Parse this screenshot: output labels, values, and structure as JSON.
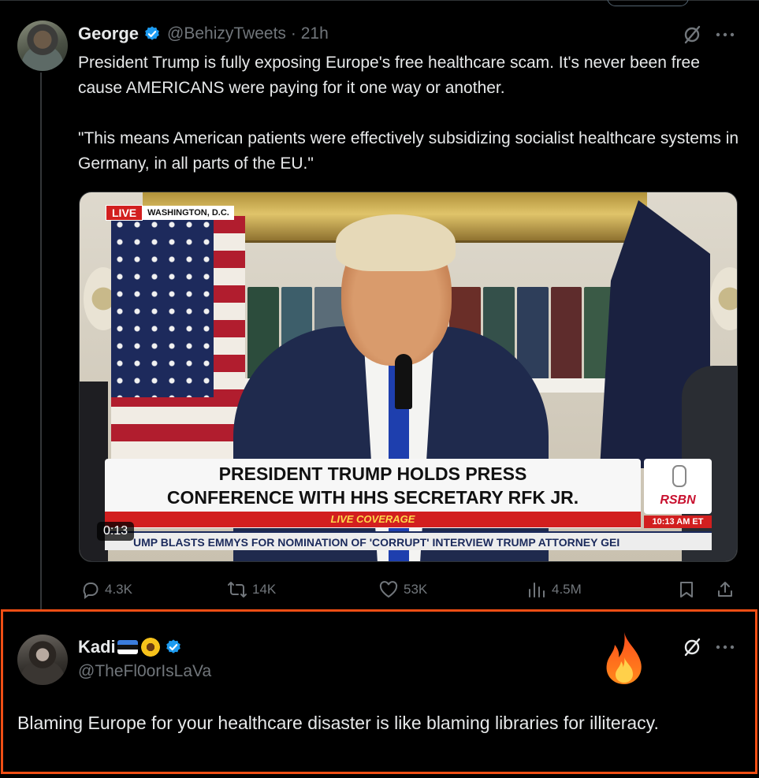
{
  "tweet": {
    "author_name": "George",
    "author_handle": "@BehizyTweets",
    "time": "· 21h",
    "text_p1": "President Trump is fully exposing Europe's free healthcare scam. It's never been free cause AMERICANS were paying for it one way or another.",
    "text_p2": "\"This means American patients were effectively subsidizing socialist healthcare systems in Germany, in all parts of the EU.\"",
    "media": {
      "live_label": "LIVE",
      "location": "WASHINGTON, D.C.",
      "headline": "PRESIDENT TRUMP HOLDS PRESS\nCONFERENCE WITH HHS SECRETARY RFK JR.",
      "live_coverage": "LIVE COVERAGE",
      "network": "RSBN",
      "clock": "10:13 AM ET",
      "ticker": "UMP BLASTS EMMYS FOR NOMINATION OF 'CORRUPT' INTERVIEW     TRUMP ATTORNEY GEI",
      "timestamp": "0:13"
    },
    "stats": {
      "replies": "4.3K",
      "reposts": "14K",
      "likes": "53K",
      "views": "4.5M"
    }
  },
  "reply": {
    "author_name": "Kadi",
    "author_handle": "@TheFl0orIsLaVa",
    "text": "Blaming Europe for your healthcare disaster is like blaming libraries for illiteracy."
  },
  "icons": {
    "grok": "grok-icon",
    "more": "more-icon",
    "verified": "verified-badge-icon",
    "reply": "reply-icon",
    "repost": "repost-icon",
    "like": "like-icon",
    "views": "views-icon",
    "bookmark": "bookmark-icon",
    "share": "share-icon",
    "fire": "fire-icon"
  },
  "colors": {
    "background": "#000000",
    "text": "#e7e9ea",
    "muted": "#71767b",
    "verified": "#1d9bf0",
    "highlight_border": "#f04e14"
  }
}
